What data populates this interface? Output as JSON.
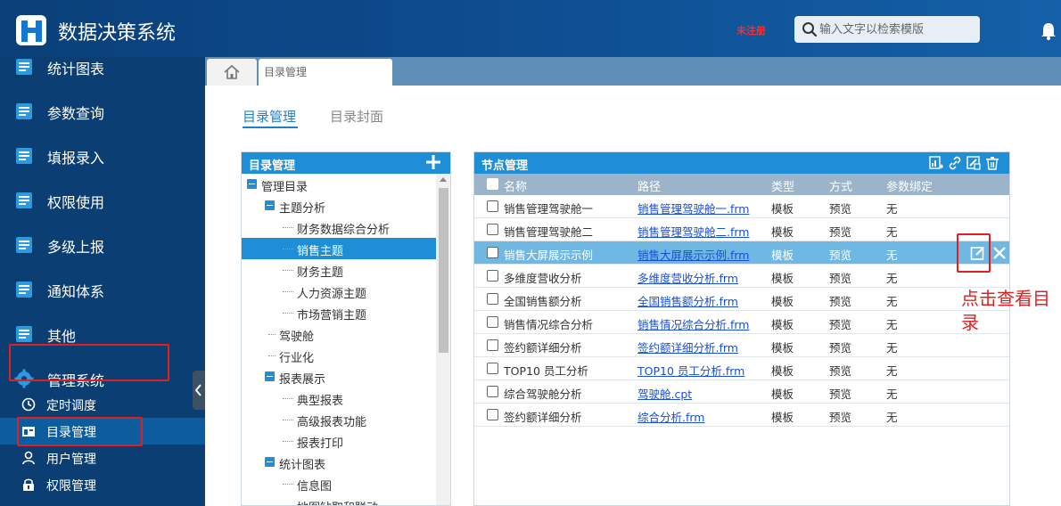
{
  "header": {
    "title": "数据决策系统",
    "unregistered": "未注册",
    "search_placeholder": "输入文字以检索模版"
  },
  "sidebar": {
    "items": [
      {
        "label": "统计图表",
        "icon": "report-icon"
      },
      {
        "label": "参数查询",
        "icon": "report-icon"
      },
      {
        "label": "填报录入",
        "icon": "report-icon"
      },
      {
        "label": "权限使用",
        "icon": "report-icon"
      },
      {
        "label": "多级上报",
        "icon": "report-icon"
      },
      {
        "label": "通知体系",
        "icon": "report-icon"
      },
      {
        "label": "其他",
        "icon": "report-icon"
      },
      {
        "label": "管理系统",
        "icon": "gear-icon"
      }
    ],
    "sub_items": [
      {
        "label": "定时调度",
        "icon": "clock-icon"
      },
      {
        "label": "目录管理",
        "icon": "folder-icon",
        "active": true
      },
      {
        "label": "用户管理",
        "icon": "user-icon"
      },
      {
        "label": "权限管理",
        "icon": "lock-icon"
      }
    ]
  },
  "tabs": {
    "page_tab": "目录管理"
  },
  "subtabs": [
    "目录管理",
    "目录封面"
  ],
  "tree": {
    "title": "目录管理",
    "rows": [
      {
        "label": "管理目录",
        "level": 0,
        "expand": true
      },
      {
        "label": "主题分析",
        "level": 1,
        "expand": true
      },
      {
        "label": "财务数据综合分析",
        "level": 2
      },
      {
        "label": "销售主题",
        "level": 2,
        "selected": true
      },
      {
        "label": "财务主题",
        "level": 2
      },
      {
        "label": "人力资源主题",
        "level": 2
      },
      {
        "label": "市场营销主题",
        "level": 2
      },
      {
        "label": "驾驶舱",
        "level": 1
      },
      {
        "label": "行业化",
        "level": 1
      },
      {
        "label": "报表展示",
        "level": 1,
        "expand": true
      },
      {
        "label": "典型报表",
        "level": 2
      },
      {
        "label": "高级报表功能",
        "level": 2
      },
      {
        "label": "报表打印",
        "level": 2
      },
      {
        "label": "统计图表",
        "level": 1,
        "expand": true
      },
      {
        "label": "信息图",
        "level": 2
      },
      {
        "label": "地图钻取和联动",
        "level": 2
      }
    ]
  },
  "node_panel": {
    "title": "节点管理",
    "columns": {
      "name": "名称",
      "path": "路径",
      "type": "类型",
      "mode": "方式",
      "bind": "参数绑定"
    },
    "rows": [
      {
        "name": "销售管理驾驶舱一",
        "path": "销售管理驾驶舱一.frm",
        "type": "模板",
        "mode": "预览",
        "bind": "无"
      },
      {
        "name": "销售管理驾驶舱二",
        "path": "销售管理驾驶舱二.frm",
        "type": "模板",
        "mode": "预览",
        "bind": "无"
      },
      {
        "name": "销售大屏展示示例",
        "path": "销售大屏展示示例.frm",
        "type": "模板",
        "mode": "预览",
        "bind": "无",
        "highlight": true
      },
      {
        "name": "多维度营收分析",
        "path": "多维度营收分析.frm",
        "type": "模板",
        "mode": "预览",
        "bind": "无"
      },
      {
        "name": "全国销售额分析",
        "path": "全国销售额分析.frm",
        "type": "模板",
        "mode": "预览",
        "bind": "无"
      },
      {
        "name": "销售情况综合分析",
        "path": "销售情况综合分析.frm",
        "type": "模板",
        "mode": "预览",
        "bind": "无"
      },
      {
        "name": "签约额详细分析",
        "path": "签约额详细分析.frm",
        "type": "模板",
        "mode": "预览",
        "bind": "无"
      },
      {
        "name": "TOP10 员工分析",
        "path": "TOP10 员工分析.frm",
        "type": "模板",
        "mode": "预览",
        "bind": "无"
      },
      {
        "name": "综合驾驶舱分析",
        "path": "驾驶舱.cpt",
        "type": "模板",
        "mode": "预览",
        "bind": "无"
      },
      {
        "name": "签约额详细分析",
        "path": "综合分析.frm",
        "type": "模板",
        "mode": "预览",
        "bind": "无"
      }
    ]
  },
  "annotation": "点击查看目录"
}
